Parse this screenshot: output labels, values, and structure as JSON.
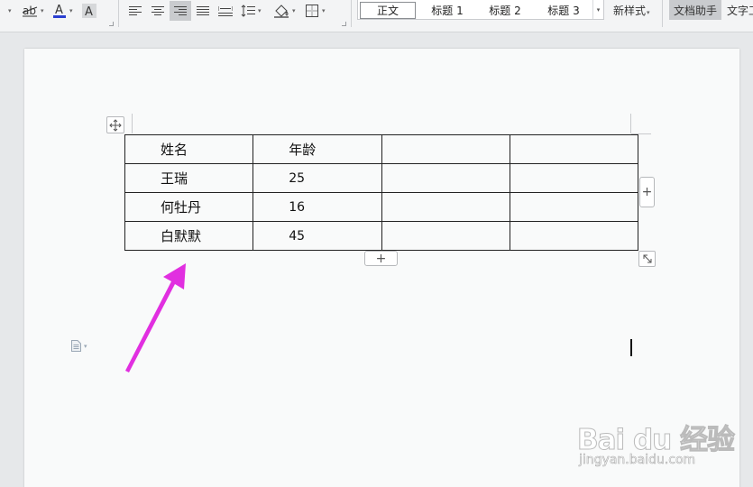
{
  "ribbon": {
    "styles": [
      "正文",
      "标题 1",
      "标题 2",
      "标题 3"
    ],
    "new_style_label": "新样式",
    "doc_assistant_label": "文档助手",
    "text_tool_label": "文字工",
    "colors": {
      "font_color_underline": "#2a3fd1",
      "active_button": "#c9cbce"
    }
  },
  "table": {
    "rows": [
      [
        "姓名",
        "年龄",
        "",
        ""
      ],
      [
        "王瑞",
        "25",
        "",
        ""
      ],
      [
        "何牡丹",
        "16",
        "",
        ""
      ],
      [
        "白默默",
        "45",
        "",
        ""
      ]
    ]
  },
  "controls": {
    "add_column_symbol": "+",
    "add_row_symbol": "+"
  },
  "annotation": {
    "arrow_color": "#e12fe0"
  },
  "watermark": {
    "brand": "Bai du 经验",
    "site": "jingyan.baidu.com"
  }
}
